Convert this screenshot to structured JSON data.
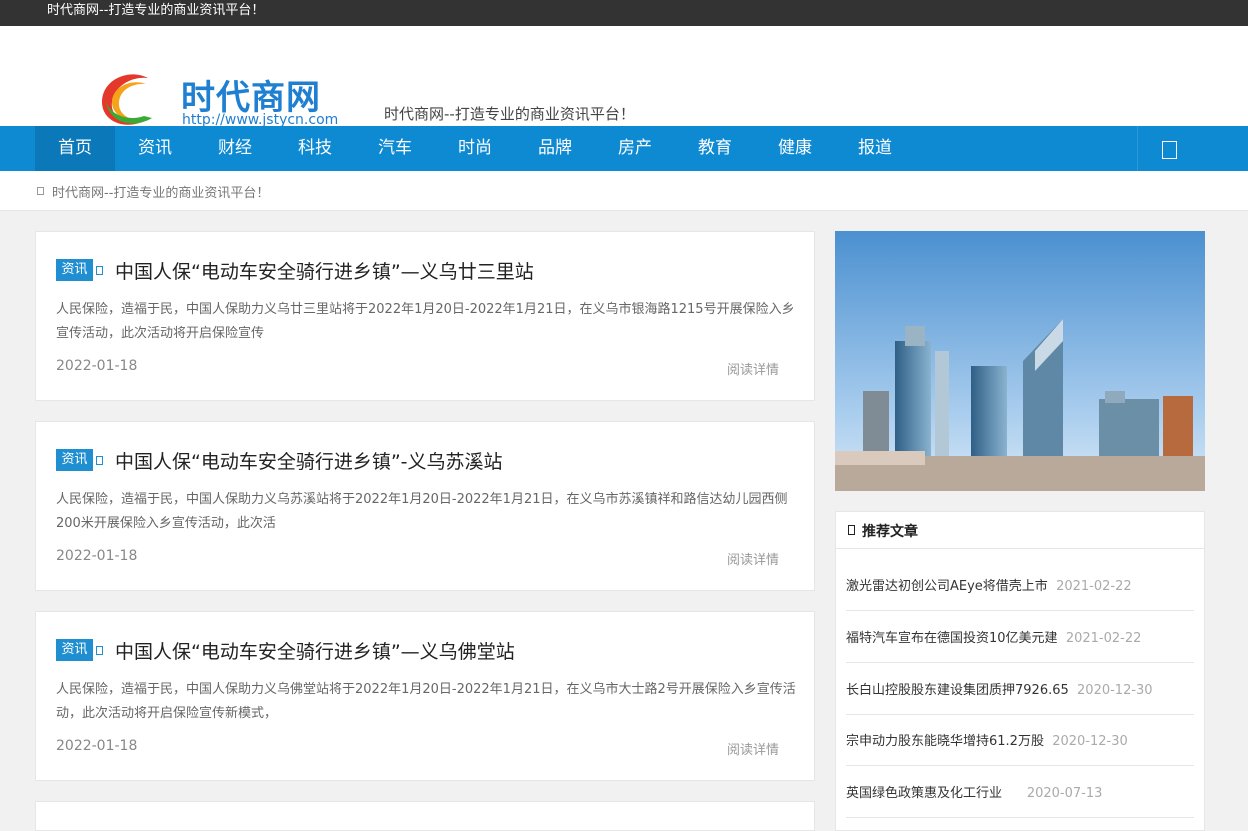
{
  "topbar": {
    "text": "时代商网--打造专业的商业资讯平台！"
  },
  "header": {
    "logo_title": "时代商网",
    "logo_url": "http://www.jstycn.com",
    "slogan": "时代商网--打造专业的商业资讯平台！",
    "logo_colors": [
      "#e4382a",
      "#f5a31b",
      "#3aaa35",
      "#1f7fd1"
    ]
  },
  "nav": {
    "items": [
      "首页",
      "资讯",
      "财经",
      "科技",
      "汽车",
      "时尚",
      "品牌",
      "房产",
      "教育",
      "健康",
      "报道"
    ],
    "active": "首页",
    "search_icon": "search-icon",
    "color": "#0e8ad3"
  },
  "breadcrumb": {
    "text": "时代商网--打造专业的商业资讯平台！",
    "icon": "home-icon"
  },
  "articles": [
    {
      "tag": "资讯",
      "title": "中国人保“电动车安全骑行进乡镇”—义乌廿三里站",
      "summary": "人民保险，造福于民，中国人保助力义乌廿三里站将于2022年1月20日-2022年1月21日，在义乌市银海路1215号开展保险入乡宣传活动，此次活动将开启保险宣传",
      "date": "2022-01-18",
      "more": "阅读详情"
    },
    {
      "tag": "资讯",
      "title": "中国人保“电动车安全骑行进乡镇”-义乌苏溪站",
      "summary": "人民保险，造福于民，中国人保助力义乌苏溪站将于2022年1月20日-2022年1月21日，在义乌市苏溪镇祥和路信达幼儿园西侧200米开展保险入乡宣传活动，此次活",
      "date": "2022-01-18",
      "more": "阅读详情"
    },
    {
      "tag": "资讯",
      "title": "中国人保“电动车安全骑行进乡镇”—义乌佛堂站",
      "summary": "人民保险，造福于民，中国人保助力义乌佛堂站将于2022年1月20日-2022年1月21日，在义乌市大士路2号开展保险入乡宣传活动，此次活动将开启保险宣传新模式，",
      "date": "2022-01-18",
      "more": "阅读详情"
    }
  ],
  "sidebar": {
    "image": "city-skyline-image",
    "widget_title": "推荐文章",
    "recommended": [
      {
        "title": "激光雷达初创公司AEye将借壳上市",
        "date": "2021-02-22"
      },
      {
        "title": "福特汽车宣布在德国投资10亿美元建",
        "date": "2021-02-22"
      },
      {
        "title": "长白山控股股东建设集团质押7926.65",
        "date": "2020-12-30"
      },
      {
        "title": "宗申动力股东能晓华增持61.2万股",
        "date": "2020-12-30"
      },
      {
        "title": "英国绿色政策惠及化工行业",
        "date": "2020-07-13"
      }
    ]
  }
}
